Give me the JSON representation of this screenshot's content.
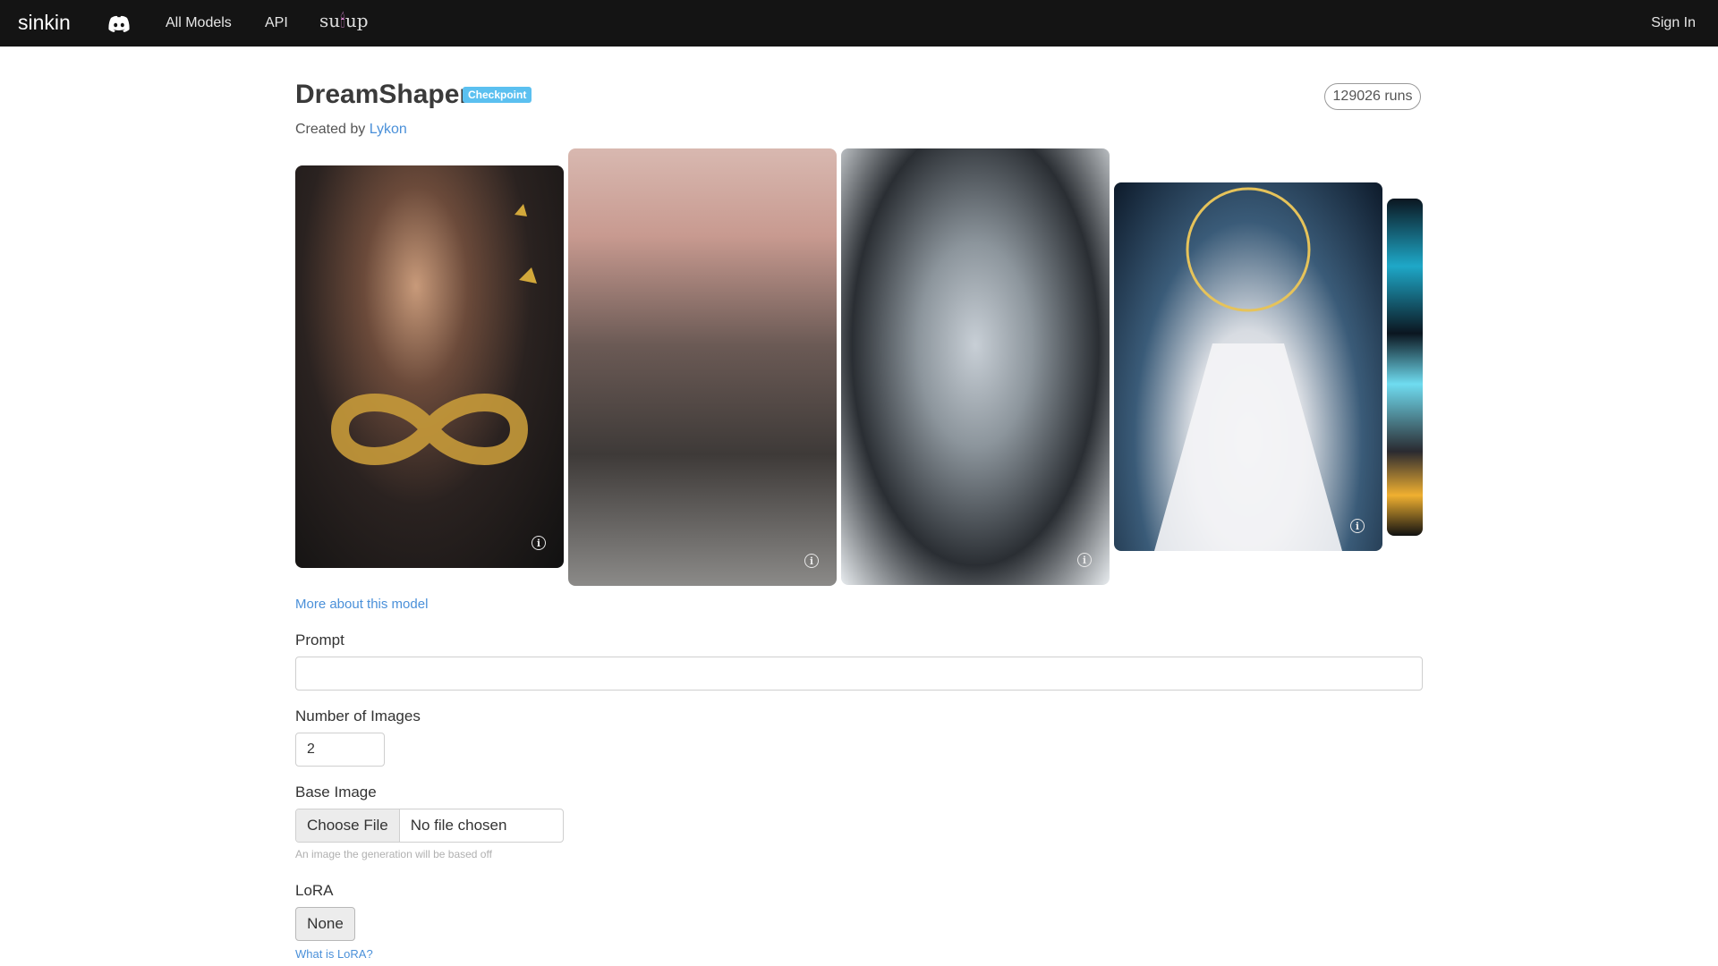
{
  "navbar": {
    "brand": "sinkin",
    "links": {
      "all_models": "All Models",
      "api": "API"
    },
    "logo_text_left": "su",
    "logo_text_right": "up",
    "sign_in": "Sign In"
  },
  "model": {
    "name": "DreamShaper",
    "badge": "Checkpoint",
    "runs": "129026 runs",
    "created_prefix": "Created by",
    "creator": "Lykon"
  },
  "gallery": {
    "info_icon": "info-icon",
    "images": [
      "card-1",
      "card-2",
      "card-3",
      "card-4",
      "card-5"
    ]
  },
  "form": {
    "more_link": "More about this model",
    "prompt_label": "Prompt",
    "prompt_value": "",
    "num_label": "Number of Images",
    "num_value": "2",
    "base_label": "Base Image",
    "choose_file": "Choose File",
    "no_file": "No file chosen",
    "base_help": "An image the generation will be based off",
    "lora_label": "LoRA",
    "lora_value": "None",
    "lora_help": "What is LoRA?"
  },
  "colors": {
    "navbar_bg": "#141414",
    "badge_bg": "#5bc0f0",
    "link": "#4a90d9"
  }
}
